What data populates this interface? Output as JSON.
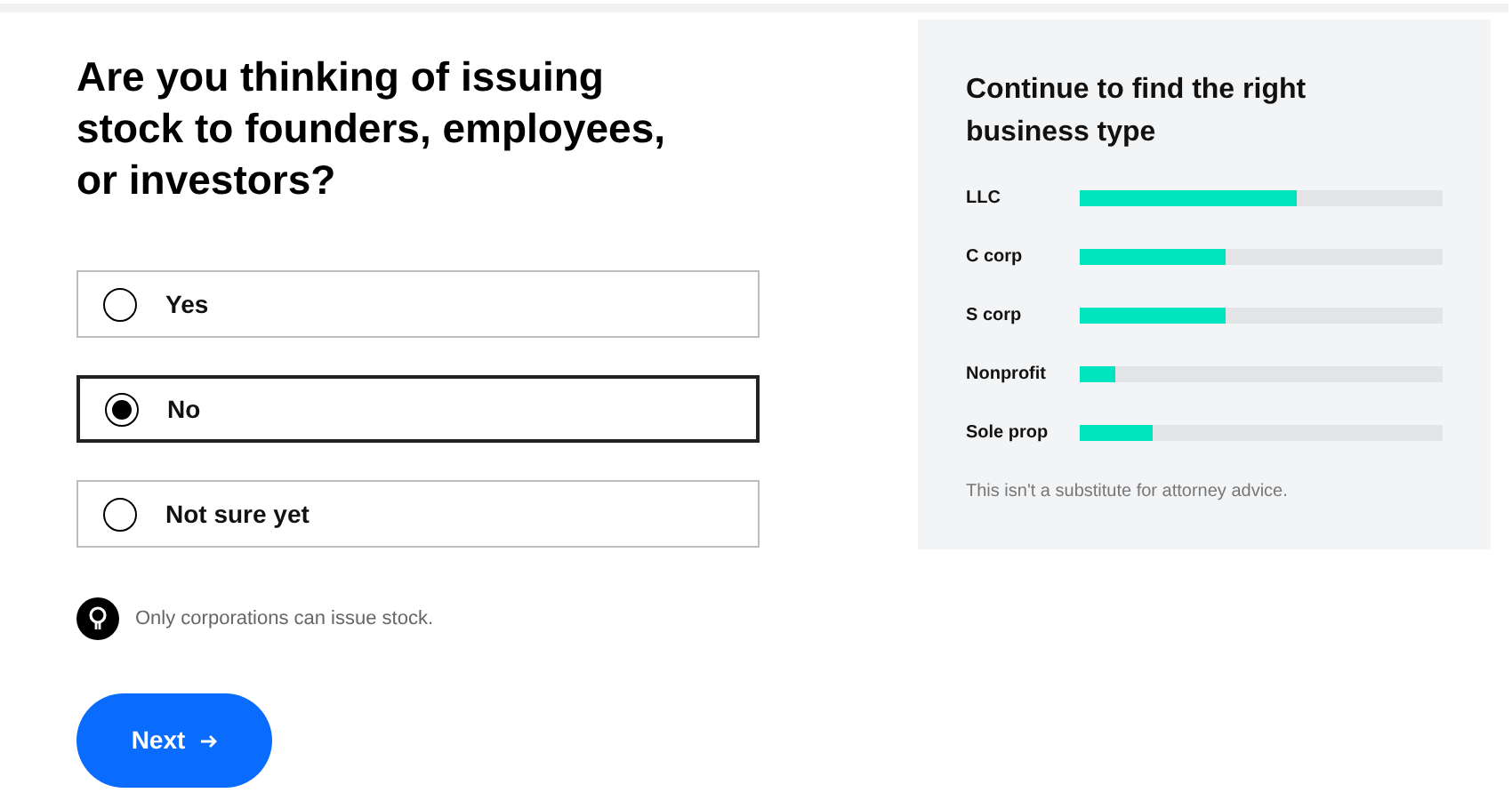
{
  "question": "Are you thinking of issuing stock to founders, employees, or investors?",
  "options": [
    {
      "label": "Yes",
      "selected": false
    },
    {
      "label": "No",
      "selected": true
    },
    {
      "label": "Not sure yet",
      "selected": false
    }
  ],
  "tip": "Only corporations can issue stock.",
  "next_button": "Next",
  "panel": {
    "title": "Continue to find the right business type",
    "types": [
      {
        "label": "LLC",
        "level": 0.6
      },
      {
        "label": "C corp",
        "level": 0.4
      },
      {
        "label": "S corp",
        "level": 0.4
      },
      {
        "label": "Nonprofit",
        "level": 0.1
      },
      {
        "label": "Sole prop",
        "level": 0.2
      }
    ],
    "disclaimer": "This isn't a substitute for attorney advice."
  }
}
